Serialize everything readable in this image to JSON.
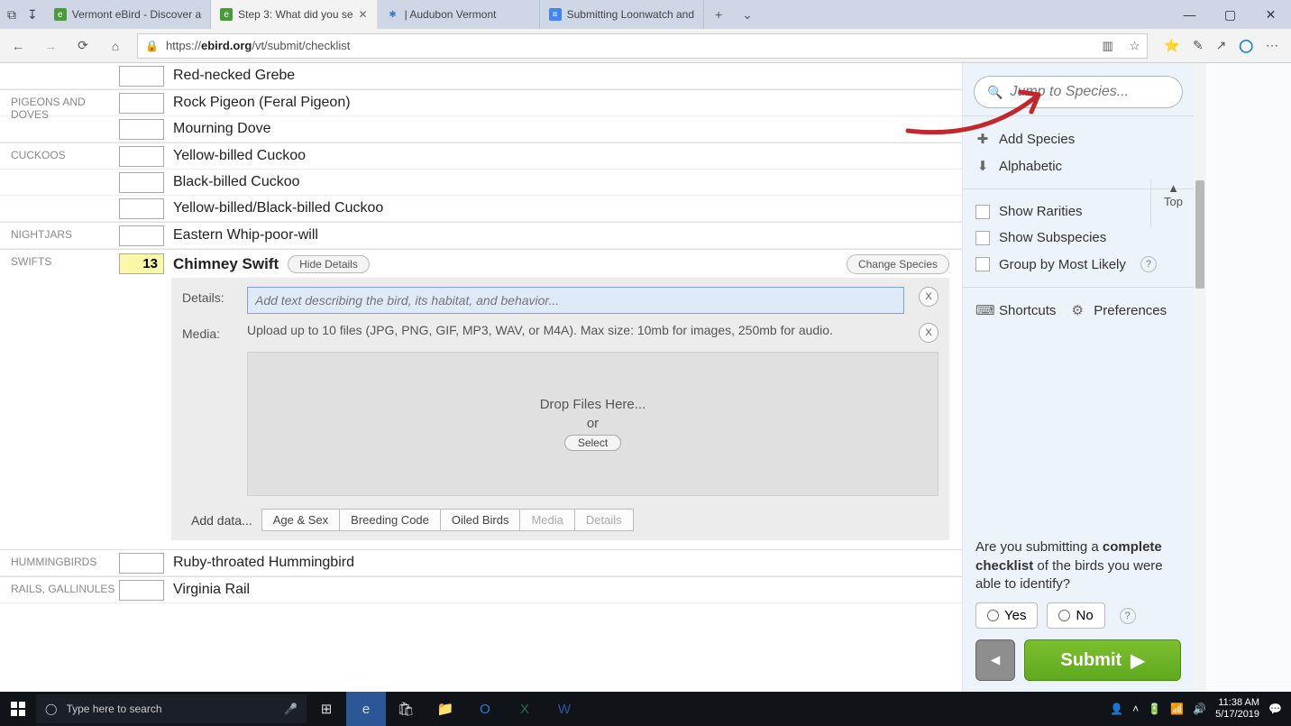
{
  "browser": {
    "tabs": [
      {
        "title": "Vermont eBird - Discover a",
        "favicon": "e"
      },
      {
        "title": "Step 3: What did you se",
        "favicon": "e"
      },
      {
        "title": "| Audubon Vermont",
        "favicon": "a"
      },
      {
        "title": "Submitting Loonwatch and",
        "favicon": "≡"
      }
    ],
    "active_tab": 1,
    "url_host": "ebird.org",
    "url_path": "/vt/submit/checklist",
    "url_prefix": "https://"
  },
  "species_groups": [
    {
      "name": "",
      "rows": [
        {
          "count": "",
          "name": "Red-necked Grebe"
        }
      ]
    },
    {
      "name": "PIGEONS AND DOVES",
      "rows": [
        {
          "count": "",
          "name": "Rock Pigeon (Feral Pigeon)"
        },
        {
          "count": "",
          "name": "Mourning Dove"
        }
      ]
    },
    {
      "name": "CUCKOOS",
      "rows": [
        {
          "count": "",
          "name": "Yellow-billed Cuckoo"
        },
        {
          "count": "",
          "name": "Black-billed Cuckoo"
        },
        {
          "count": "",
          "name": "Yellow-billed/Black-billed Cuckoo"
        }
      ]
    },
    {
      "name": "NIGHTJARS",
      "rows": [
        {
          "count": "",
          "name": "Eastern Whip-poor-will"
        }
      ]
    },
    {
      "name": "SWIFTS",
      "expanded": true,
      "rows": [
        {
          "count": "13",
          "name": "Chimney Swift"
        }
      ]
    },
    {
      "name": "HUMMINGBIRDS",
      "rows": [
        {
          "count": "",
          "name": "Ruby-throated Hummingbird"
        }
      ]
    },
    {
      "name": "RAILS, GALLINULES",
      "rows": [
        {
          "count": "",
          "name": "Virginia Rail"
        }
      ]
    }
  ],
  "expanded": {
    "hide_details": "Hide Details",
    "change_species": "Change Species",
    "details_label": "Details:",
    "details_placeholder": "Add text describing the bird, its habitat, and behavior...",
    "media_label": "Media:",
    "media_help": "Upload up to 10 files (JPG, PNG, GIF, MP3, WAV, or M4A). Max size: 10mb for images, 250mb for audio.",
    "drop_text": "Drop Files Here...",
    "or_text": "or",
    "select_text": "Select",
    "close_x": "X",
    "add_data": "Add data...",
    "tabs": [
      "Age & Sex",
      "Breeding Code",
      "Oiled Birds",
      "Media",
      "Details"
    ]
  },
  "sidebar": {
    "search_placeholder": "Jump to Species...",
    "add_species": "Add Species",
    "alphabetic": "Alphabetic",
    "top": "Top",
    "show_rarities": "Show Rarities",
    "show_subspecies": "Show Subspecies",
    "group_likely": "Group by Most Likely",
    "shortcuts": "Shortcuts",
    "preferences": "Preferences",
    "question_pre": "Are you submitting a ",
    "question_bold": "complete checklist",
    "question_post": " of the birds you were able to identify?",
    "yes": "Yes",
    "no": "No",
    "submit": "Submit"
  },
  "taskbar": {
    "search_placeholder": "Type here to search",
    "time": "11:38 AM",
    "date": "5/17/2019"
  }
}
